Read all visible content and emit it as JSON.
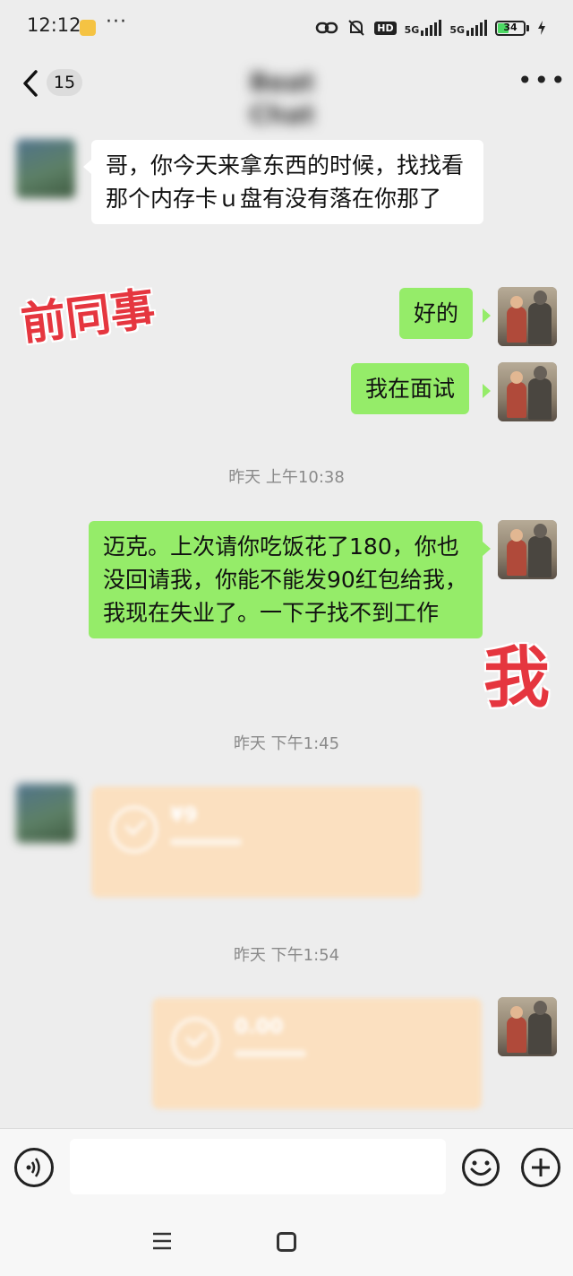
{
  "status_bar": {
    "time": "12:12",
    "more": "···",
    "hd_badge": "HD",
    "network_1": "5G",
    "network_2": "5G",
    "battery": "34"
  },
  "nav": {
    "unread_count": "15",
    "title": "Beat Chat"
  },
  "messages": [
    {
      "side": "left",
      "text": "哥，你今天来拿东西的时候，找找看那个内存卡ｕ盘有没有落在你那了"
    },
    {
      "side": "right",
      "text": "好的"
    },
    {
      "side": "right",
      "text": "我在面试"
    },
    {
      "type": "timestamp",
      "text": "昨天 上午10:38"
    },
    {
      "side": "right",
      "text": "迈克。上次请你吃饭花了180，你也没回请我，你能不能发90红包给我，我现在失业了。一下子找不到工作"
    },
    {
      "type": "timestamp",
      "text": "昨天 下午1:45"
    },
    {
      "side": "left",
      "type": "red_packet",
      "amount": "¥9"
    },
    {
      "type": "timestamp",
      "text": "昨天 下午1:54"
    },
    {
      "side": "right",
      "type": "red_packet",
      "amount": "0.00"
    }
  ],
  "annotations": {
    "coworker": "前同事",
    "me": "我"
  },
  "input": {
    "placeholder": ""
  },
  "colors": {
    "my_bubble": "#95ec69",
    "their_bubble": "#ffffff",
    "background": "#ededed",
    "annotation": "#e5363f",
    "red_packet": "#fbe0c0"
  }
}
